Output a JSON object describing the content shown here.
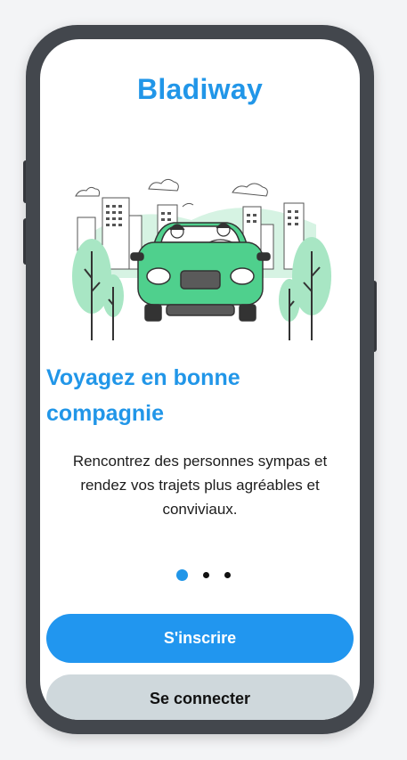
{
  "app": {
    "title": "Bladiway"
  },
  "onboarding": {
    "headline": "Voyagez en bonne compagnie",
    "description": "Rencontrez des personnes sympas et rendez vos trajets plus agréables et conviviaux.",
    "current_page": 1,
    "total_pages": 3,
    "illustration": "car-ride-with-passengers-city-illustration"
  },
  "actions": {
    "signup_label": "S'inscrire",
    "login_label": "Se connecter"
  },
  "colors": {
    "accent": "#2196e8",
    "secondary_button": "#cfd8dc",
    "car": "#4fd08d",
    "trees": "#a8e6c4"
  }
}
